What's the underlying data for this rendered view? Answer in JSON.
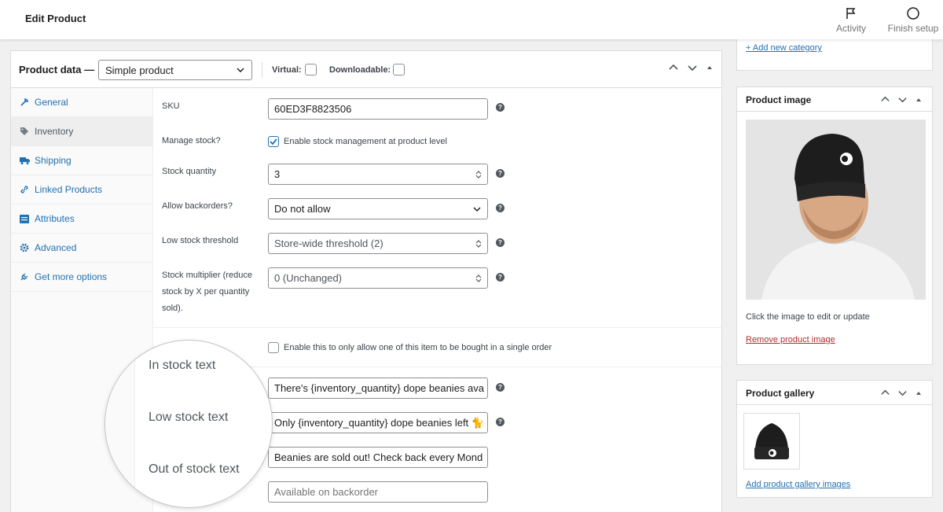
{
  "topbar": {
    "title": "Edit Product",
    "activity_label": "Activity",
    "finish_label": "Finish setup"
  },
  "product_data": {
    "label": "Product data —",
    "type_value": "Simple product",
    "virtual_label": "Virtual:",
    "downloadable_label": "Downloadable:"
  },
  "nav": [
    {
      "label": "General",
      "icon": "wrench-icon"
    },
    {
      "label": "Inventory",
      "icon": "tag-icon"
    },
    {
      "label": "Shipping",
      "icon": "truck-icon"
    },
    {
      "label": "Linked Products",
      "icon": "link-icon"
    },
    {
      "label": "Attributes",
      "icon": "list-icon"
    },
    {
      "label": "Advanced",
      "icon": "gear-icon"
    },
    {
      "label": "Get more options",
      "icon": "plug-icon"
    }
  ],
  "inventory": {
    "sku_label": "SKU",
    "sku_value": "60ED3F8823506",
    "manage_stock_label": "Manage stock?",
    "manage_stock_text": "Enable stock management at product level",
    "stock_qty_label": "Stock quantity",
    "stock_qty_value": "3",
    "backorders_label": "Allow backorders?",
    "backorders_value": "Do not allow",
    "low_stock_label": "Low stock threshold",
    "low_stock_value": "Store-wide threshold (2)",
    "multiplier_label_1": "Stock multiplier (reduce",
    "multiplier_label_2": "stock by X per quantity",
    "multiplier_label_3": "sold).",
    "multiplier_value": "0 (Unchanged)",
    "sold_individually_text": "Enable this to only allow one of this item to be bought in a single order",
    "in_stock_value": "There's {inventory_quantity} dope beanies ava",
    "low_stock_text_value": "Only {inventory_quantity} dope beanies left 🐈",
    "out_of_stock_value": "Beanies are sold out! Check back every Mond",
    "backorder_placeholder": "Available on backorder"
  },
  "magnifier": {
    "in_stock_label": "In stock text",
    "low_stock_label": "Low stock text",
    "out_of_stock_label": "Out of stock text"
  },
  "category_box": {
    "add_link": "+ Add new category"
  },
  "product_image_box": {
    "title": "Product image",
    "hint": "Click the image to edit or update",
    "remove_link": "Remove product image"
  },
  "gallery_box": {
    "title": "Product gallery",
    "add_link": "Add product gallery images"
  },
  "colors": {
    "link": "#2271b1",
    "danger": "#b32d2e",
    "border": "#dcdcde"
  }
}
